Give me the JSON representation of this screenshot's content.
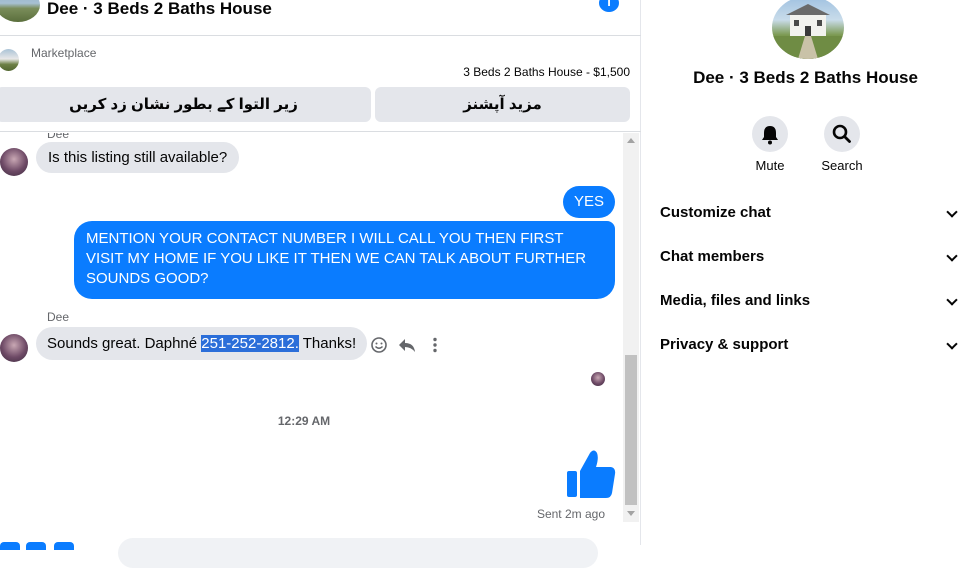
{
  "header": {
    "title": "Dee · 3 Beds 2 Baths House",
    "info_icon": "i"
  },
  "marketplace": {
    "label": "Marketplace",
    "listing_price": "3 Beds 2 Baths House - $1,500",
    "button_mark_sold": "زیر التوا کے بطور نشان زد کریں",
    "button_more": "مزید آپشنز"
  },
  "messages": {
    "sender_top": "Dee",
    "m1": "Is this listing still available?",
    "m2": "YES",
    "m3": "MENTION YOUR CONTACT NUMBER I WILL CALL YOU THEN FIRST VISIT MY HOME IF YOU LIKE IT THEN WE CAN TALK ABOUT FURTHER SOUNDS GOOD?",
    "sender": "Dee",
    "m4_pre": "Sounds great. Daphné ",
    "m4_highlight": "251-252-2812.",
    "m4_post": " Thanks!",
    "timestamp": "12:29 AM",
    "sent_status": "Sent 2m ago"
  },
  "panel": {
    "name": "Dee · 3 Beds 2 Baths House",
    "actions": [
      {
        "label": "Mute",
        "icon": "bell-icon"
      },
      {
        "label": "Search",
        "icon": "search-icon"
      }
    ],
    "rows": [
      {
        "label": "Customize chat"
      },
      {
        "label": "Chat members"
      },
      {
        "label": "Media, files and links"
      },
      {
        "label": "Privacy & support"
      }
    ]
  },
  "colors": {
    "accent": "#0a7cff",
    "bubble_in": "#e4e6eb",
    "highlight": "#2b6ed9"
  }
}
